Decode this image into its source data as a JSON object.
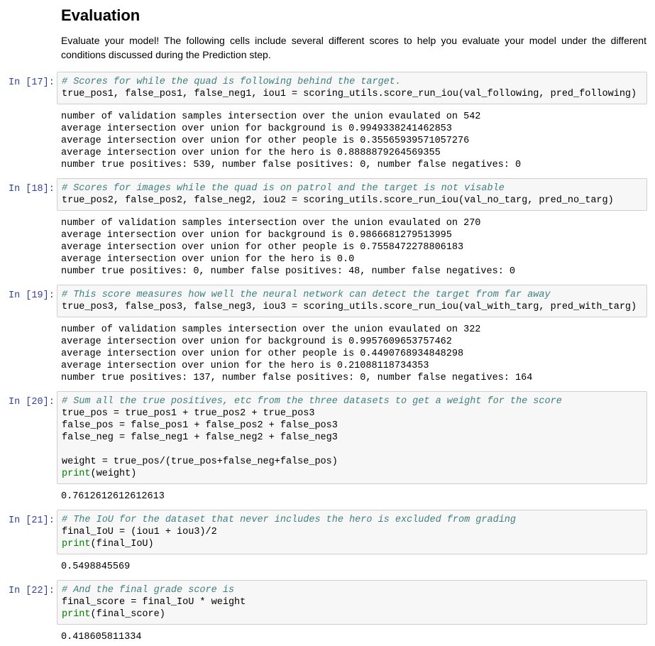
{
  "heading": "Evaluation",
  "intro": "Evaluate your model! The following cells include several different scores to help you evaluate your model under the different conditions discussed during the Prediction step.",
  "cells": [
    {
      "prompt": "In [17]:",
      "code": [
        {
          "cls": "comment",
          "text": "# Scores for while the quad is following behind the target."
        },
        {
          "cls": "",
          "text": "true_pos1, false_pos1, false_neg1, iou1 = scoring_utils.score_run_iou(val_following, pred_following)"
        }
      ],
      "output": [
        "number of validation samples intersection over the union evaulated on 542",
        "average intersection over union for background is 0.9949338241462853",
        "average intersection over union for other people is 0.35565939571057276",
        "average intersection over union for the hero is 0.8888879264569355",
        "number true positives: 539, number false positives: 0, number false negatives: 0"
      ]
    },
    {
      "prompt": "In [18]:",
      "code": [
        {
          "cls": "comment",
          "text": "# Scores for images while the quad is on patrol and the target is not visable"
        },
        {
          "cls": "",
          "text": "true_pos2, false_pos2, false_neg2, iou2 = scoring_utils.score_run_iou(val_no_targ, pred_no_targ)"
        }
      ],
      "output": [
        "number of validation samples intersection over the union evaulated on 270",
        "average intersection over union for background is 0.9866681279513995",
        "average intersection over union for other people is 0.7558472278806183",
        "average intersection over union for the hero is 0.0",
        "number true positives: 0, number false positives: 48, number false negatives: 0"
      ]
    },
    {
      "prompt": "In [19]:",
      "code": [
        {
          "cls": "comment",
          "text": "# This score measures how well the neural network can detect the target from far away"
        },
        {
          "cls": "",
          "text": "true_pos3, false_pos3, false_neg3, iou3 = scoring_utils.score_run_iou(val_with_targ, pred_with_targ)"
        }
      ],
      "output": [
        "number of validation samples intersection over the union evaulated on 322",
        "average intersection over union for background is 0.9957609653757462",
        "average intersection over union for other people is 0.4490768934848298",
        "average intersection over union for the hero is 0.21088118734353",
        "number true positives: 137, number false positives: 0, number false negatives: 164"
      ]
    },
    {
      "prompt": "In [20]:",
      "code": [
        {
          "cls": "comment",
          "text": "# Sum all the true positives, etc from the three datasets to get a weight for the score"
        },
        {
          "cls": "",
          "text": "true_pos = true_pos1 + true_pos2 + true_pos3"
        },
        {
          "cls": "",
          "text": "false_pos = false_pos1 + false_pos2 + false_pos3"
        },
        {
          "cls": "",
          "text": "false_neg = false_neg1 + false_neg2 + false_neg3"
        },
        {
          "cls": "",
          "text": ""
        },
        {
          "cls": "",
          "text": "weight = true_pos/(true_pos+false_neg+false_pos)"
        },
        {
          "cls": "call",
          "fn": "print",
          "arg": "(weight)"
        }
      ],
      "output": [
        "0.7612612612612613"
      ]
    },
    {
      "prompt": "In [21]:",
      "code": [
        {
          "cls": "comment",
          "text": "# The IoU for the dataset that never includes the hero is excluded from grading"
        },
        {
          "cls": "",
          "text": "final_IoU = (iou1 + iou3)/2"
        },
        {
          "cls": "call",
          "fn": "print",
          "arg": "(final_IoU)"
        }
      ],
      "output": [
        "0.5498845569"
      ]
    },
    {
      "prompt": "In [22]:",
      "code": [
        {
          "cls": "comment",
          "text": "# And the final grade score is"
        },
        {
          "cls": "",
          "text": "final_score = final_IoU * weight"
        },
        {
          "cls": "call",
          "fn": "print",
          "arg": "(final_score)"
        }
      ],
      "output": [
        "0.418605811334"
      ]
    }
  ]
}
